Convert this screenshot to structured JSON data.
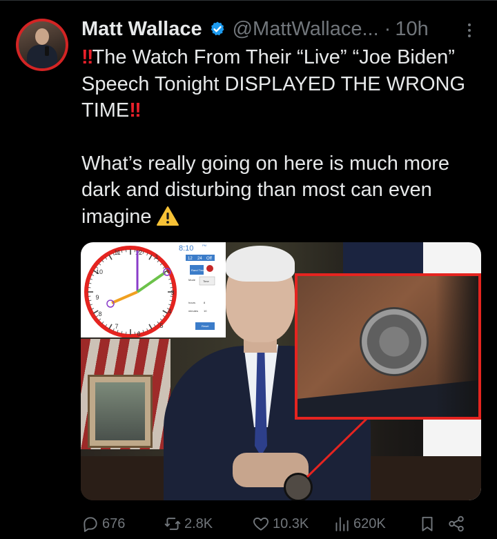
{
  "post": {
    "author_name": "Matt Wallace",
    "handle": "@MattWallace...",
    "separator": "·",
    "time": "10h",
    "text_line1": "The Watch From Their “Live” “Joe Biden” Speech Tonight DISPLAYED THE WRONG TIME",
    "text_line2": "What’s really going on here is much more dark and disturbing than most can even imagine",
    "bang_glyph": "‼"
  },
  "clock_graphic": {
    "digital_time": "8:10",
    "suffix": "PM",
    "toggle_12": "12",
    "toggle_24": "24",
    "toggle_off": "Off",
    "btn_random": "Rand Time",
    "label_mode": "Mode",
    "mode_value": "Time",
    "label_hours": "hours",
    "hours_value": "8",
    "label_minutes": "minutes",
    "minutes_value": "10",
    "btn_reset": "Reset",
    "numbers": [
      "12",
      "1",
      "2",
      "3",
      "4",
      "5",
      "6",
      "7",
      "8",
      "9",
      "10",
      "11"
    ]
  },
  "actions": {
    "replies": "676",
    "reposts": "2.8K",
    "likes": "10.3K",
    "views": "620K"
  },
  "colors": {
    "background": "#000000",
    "text": "#e7e9ea",
    "muted": "#71767b",
    "verified_blue": "#1d9bf0",
    "alert_red": "#e8202a",
    "highlight_red": "#e52420"
  }
}
